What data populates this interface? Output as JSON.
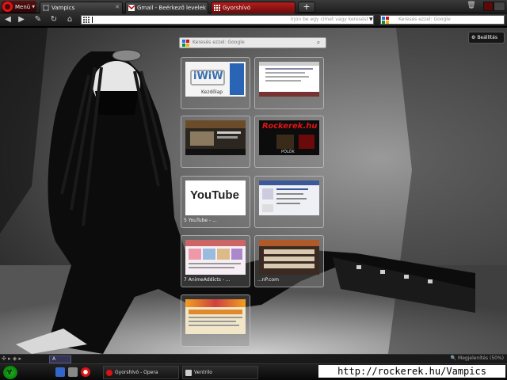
{
  "browser": {
    "menu_label": "Menü",
    "tabs": [
      {
        "title": "Vampics",
        "active": false
      },
      {
        "title": "Gmail - Beérkező levelek ...",
        "active": false
      },
      {
        "title": "Gyorshívó",
        "active": true
      }
    ],
    "address_bar": {
      "value": "",
      "placeholder": "Írjon be egy címet vagy keresést"
    },
    "search_bar": {
      "placeholder": "Keresés ezzel: Google"
    }
  },
  "speed_dial": {
    "search_placeholder": "Keresés ezzel: Google",
    "settings_label": "Beállítás",
    "dials": [
      {
        "label": "",
        "site": "iwiw",
        "thumb_text": "iWiW",
        "thumb_sub": "Kezdőlap"
      },
      {
        "label": "",
        "site": "generic-page",
        "thumb_text": "",
        "thumb_sub": ""
      },
      {
        "label": "",
        "site": "dark-site",
        "thumb_text": "",
        "thumb_sub": ""
      },
      {
        "label": "",
        "site": "rockerek",
        "thumb_text": "Rockerek.hu",
        "thumb_sub": "PÓLÓK"
      },
      {
        "label": "5 YouTube - ...",
        "site": "youtube",
        "thumb_text": "YouTube",
        "thumb_sub": ""
      },
      {
        "label": "",
        "site": "facebook",
        "thumb_text": "",
        "thumb_sub": ""
      },
      {
        "label": "7 AnimeAddicts - ...",
        "site": "animeaddicts",
        "thumb_text": "",
        "thumb_sub": ""
      },
      {
        "label": "...nP.com",
        "site": "forum",
        "thumb_text": "",
        "thumb_sub": ""
      },
      {
        "label": "",
        "site": "colorful-site",
        "thumb_text": "",
        "thumb_sub": ""
      }
    ]
  },
  "status": {
    "zoom_value": "A",
    "zoom_label": "Megjelenítés (50%)"
  },
  "taskbar": {
    "tasks": [
      {
        "label": "Gyorshívó - Opera"
      },
      {
        "label": "Ventrilo"
      }
    ]
  },
  "watermark": "http://rockerek.hu/Vampics",
  "colors": {
    "accent": "#b51d1d",
    "chrome_dark": "#1e1e1e",
    "youtube_red": "#cc181e",
    "facebook_blue": "#3b5998"
  }
}
